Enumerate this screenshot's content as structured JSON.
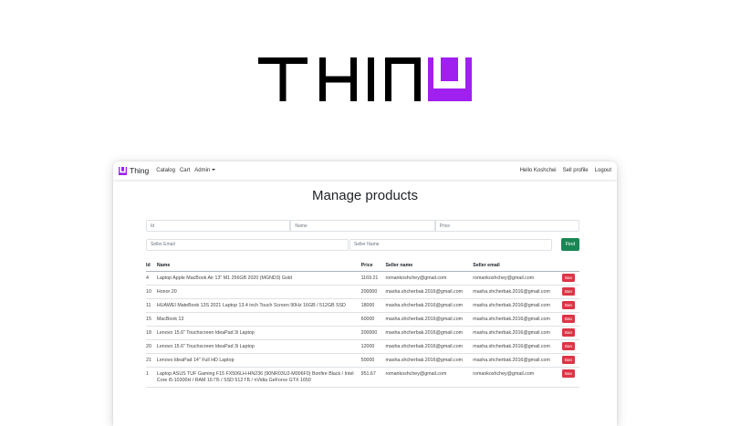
{
  "app": {
    "name": "Thing"
  },
  "nav": {
    "links": [
      "Catalog",
      "Cart",
      "Admin"
    ],
    "greeting": "Hello Koshchei",
    "sell_profile": "Sell profile",
    "logout": "Logout"
  },
  "page": {
    "title": "Manage products"
  },
  "filters": {
    "id_placeholder": "Id",
    "name_placeholder": "Name",
    "price_placeholder": "Price",
    "seller_email_placeholder": "Seller Email",
    "seller_name_placeholder": "Seller Name",
    "find_label": "Find"
  },
  "table": {
    "headers": [
      "Id",
      "Name",
      "Price",
      "Seller name",
      "Seller email"
    ],
    "ban_label": "Ban",
    "rows": [
      {
        "id": "4",
        "name": "Laptop Apple MacBook Air 13\" M1 256GB 2020 (MGND3) Gold",
        "price": "1169.21",
        "seller_name": "romankoshchey@gmail.com",
        "seller_email": "romankoshchey@gmail.com"
      },
      {
        "id": "10",
        "name": "Honor 20",
        "price": "200000",
        "seller_name": "masha.shcherbak.2016@gmail.com",
        "seller_email": "masha.shcherbak.2016@gmail.com"
      },
      {
        "id": "11",
        "name": "HUAWEI MateBook 13S 2021 Laptop 13.4 inch Touch Screen 90Hz 16GB / 512GB SSD",
        "price": "18000",
        "seller_name": "masha.shcherbak.2016@gmail.com",
        "seller_email": "masha.shcherbak.2016@gmail.com"
      },
      {
        "id": "15",
        "name": "MacBook 13",
        "price": "60000",
        "seller_name": "masha.shcherbak.2016@gmail.com",
        "seller_email": "masha.shcherbak.2016@gmail.com"
      },
      {
        "id": "18",
        "name": "Lenovo 15.6\" Touchscreen IdeaPad 3i Laptop",
        "price": "200000",
        "seller_name": "masha.shcherbak.2016@gmail.com",
        "seller_email": "masha.shcherbak.2016@gmail.com"
      },
      {
        "id": "20",
        "name": "Lenovo 15.6\" Touchscreen IdeaPad 3i Laptop",
        "price": "12000",
        "seller_name": "masha.shcherbak.2016@gmail.com",
        "seller_email": "masha.shcherbak.2016@gmail.com"
      },
      {
        "id": "21",
        "name": "Lenovo IdeaPad 14\" Full HD Laptop",
        "price": "50000",
        "seller_name": "masha.shcherbak.2016@gmail.com",
        "seller_email": "masha.shcherbak.2016@gmail.com"
      },
      {
        "id": "1",
        "name": "Laptop ASUS TUF Gaming F15 FX506LH-HN236 (90NR03U2-M006F0) Bonfire Black / Intel Core i5-10300H / RAM 16 ГБ / SSD 512 ГБ / nVidia GeForce GTX 1650",
        "price": "951.67",
        "seller_name": "romankoshchey@gmail.com",
        "seller_email": "romankoshchey@gmail.com"
      }
    ]
  },
  "colors": {
    "brand_purple": "#a020f0",
    "find_green": "#198754",
    "ban_red": "#dc3545"
  },
  "icons": {
    "hero_logo": "thing-logo-icon",
    "brand": "thing-brand-icon"
  }
}
